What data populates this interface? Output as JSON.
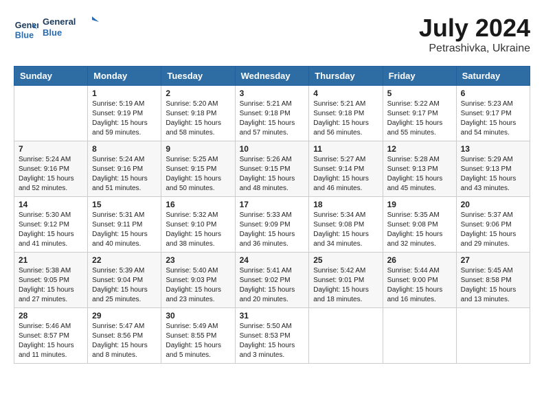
{
  "header": {
    "logo_line1": "General",
    "logo_line2": "Blue",
    "month_year": "July 2024",
    "location": "Petrashivka, Ukraine"
  },
  "weekdays": [
    "Sunday",
    "Monday",
    "Tuesday",
    "Wednesday",
    "Thursday",
    "Friday",
    "Saturday"
  ],
  "weeks": [
    [
      {
        "day": "",
        "info": ""
      },
      {
        "day": "1",
        "info": "Sunrise: 5:19 AM\nSunset: 9:19 PM\nDaylight: 15 hours\nand 59 minutes."
      },
      {
        "day": "2",
        "info": "Sunrise: 5:20 AM\nSunset: 9:18 PM\nDaylight: 15 hours\nand 58 minutes."
      },
      {
        "day": "3",
        "info": "Sunrise: 5:21 AM\nSunset: 9:18 PM\nDaylight: 15 hours\nand 57 minutes."
      },
      {
        "day": "4",
        "info": "Sunrise: 5:21 AM\nSunset: 9:18 PM\nDaylight: 15 hours\nand 56 minutes."
      },
      {
        "day": "5",
        "info": "Sunrise: 5:22 AM\nSunset: 9:17 PM\nDaylight: 15 hours\nand 55 minutes."
      },
      {
        "day": "6",
        "info": "Sunrise: 5:23 AM\nSunset: 9:17 PM\nDaylight: 15 hours\nand 54 minutes."
      }
    ],
    [
      {
        "day": "7",
        "info": "Sunrise: 5:24 AM\nSunset: 9:16 PM\nDaylight: 15 hours\nand 52 minutes."
      },
      {
        "day": "8",
        "info": "Sunrise: 5:24 AM\nSunset: 9:16 PM\nDaylight: 15 hours\nand 51 minutes."
      },
      {
        "day": "9",
        "info": "Sunrise: 5:25 AM\nSunset: 9:15 PM\nDaylight: 15 hours\nand 50 minutes."
      },
      {
        "day": "10",
        "info": "Sunrise: 5:26 AM\nSunset: 9:15 PM\nDaylight: 15 hours\nand 48 minutes."
      },
      {
        "day": "11",
        "info": "Sunrise: 5:27 AM\nSunset: 9:14 PM\nDaylight: 15 hours\nand 46 minutes."
      },
      {
        "day": "12",
        "info": "Sunrise: 5:28 AM\nSunset: 9:13 PM\nDaylight: 15 hours\nand 45 minutes."
      },
      {
        "day": "13",
        "info": "Sunrise: 5:29 AM\nSunset: 9:13 PM\nDaylight: 15 hours\nand 43 minutes."
      }
    ],
    [
      {
        "day": "14",
        "info": "Sunrise: 5:30 AM\nSunset: 9:12 PM\nDaylight: 15 hours\nand 41 minutes."
      },
      {
        "day": "15",
        "info": "Sunrise: 5:31 AM\nSunset: 9:11 PM\nDaylight: 15 hours\nand 40 minutes."
      },
      {
        "day": "16",
        "info": "Sunrise: 5:32 AM\nSunset: 9:10 PM\nDaylight: 15 hours\nand 38 minutes."
      },
      {
        "day": "17",
        "info": "Sunrise: 5:33 AM\nSunset: 9:09 PM\nDaylight: 15 hours\nand 36 minutes."
      },
      {
        "day": "18",
        "info": "Sunrise: 5:34 AM\nSunset: 9:08 PM\nDaylight: 15 hours\nand 34 minutes."
      },
      {
        "day": "19",
        "info": "Sunrise: 5:35 AM\nSunset: 9:08 PM\nDaylight: 15 hours\nand 32 minutes."
      },
      {
        "day": "20",
        "info": "Sunrise: 5:37 AM\nSunset: 9:06 PM\nDaylight: 15 hours\nand 29 minutes."
      }
    ],
    [
      {
        "day": "21",
        "info": "Sunrise: 5:38 AM\nSunset: 9:05 PM\nDaylight: 15 hours\nand 27 minutes."
      },
      {
        "day": "22",
        "info": "Sunrise: 5:39 AM\nSunset: 9:04 PM\nDaylight: 15 hours\nand 25 minutes."
      },
      {
        "day": "23",
        "info": "Sunrise: 5:40 AM\nSunset: 9:03 PM\nDaylight: 15 hours\nand 23 minutes."
      },
      {
        "day": "24",
        "info": "Sunrise: 5:41 AM\nSunset: 9:02 PM\nDaylight: 15 hours\nand 20 minutes."
      },
      {
        "day": "25",
        "info": "Sunrise: 5:42 AM\nSunset: 9:01 PM\nDaylight: 15 hours\nand 18 minutes."
      },
      {
        "day": "26",
        "info": "Sunrise: 5:44 AM\nSunset: 9:00 PM\nDaylight: 15 hours\nand 16 minutes."
      },
      {
        "day": "27",
        "info": "Sunrise: 5:45 AM\nSunset: 8:58 PM\nDaylight: 15 hours\nand 13 minutes."
      }
    ],
    [
      {
        "day": "28",
        "info": "Sunrise: 5:46 AM\nSunset: 8:57 PM\nDaylight: 15 hours\nand 11 minutes."
      },
      {
        "day": "29",
        "info": "Sunrise: 5:47 AM\nSunset: 8:56 PM\nDaylight: 15 hours\nand 8 minutes."
      },
      {
        "day": "30",
        "info": "Sunrise: 5:49 AM\nSunset: 8:55 PM\nDaylight: 15 hours\nand 5 minutes."
      },
      {
        "day": "31",
        "info": "Sunrise: 5:50 AM\nSunset: 8:53 PM\nDaylight: 15 hours\nand 3 minutes."
      },
      {
        "day": "",
        "info": ""
      },
      {
        "day": "",
        "info": ""
      },
      {
        "day": "",
        "info": ""
      }
    ]
  ]
}
